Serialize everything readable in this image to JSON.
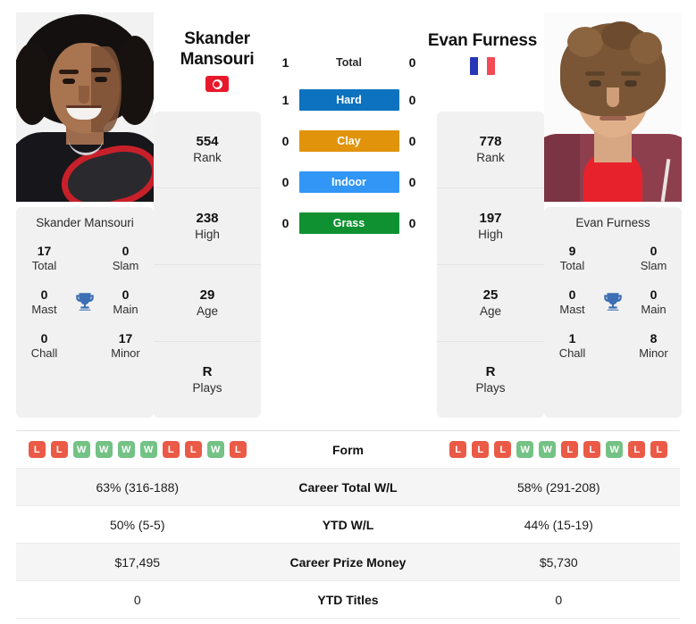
{
  "players": {
    "left": {
      "name_line1": "Skander",
      "name_line2": "Mansouri",
      "full_name": "Skander Mansouri",
      "country_flag": "tunisia-flag",
      "rank": "554",
      "rank_label": "Rank",
      "high": "238",
      "high_label": "High",
      "age": "29",
      "age_label": "Age",
      "plays": "R",
      "plays_label": "Plays",
      "titles": {
        "total": "17",
        "total_label": "Total",
        "slam": "0",
        "slam_label": "Slam",
        "mast": "0",
        "mast_label": "Mast",
        "main": "0",
        "main_label": "Main",
        "chall": "0",
        "chall_label": "Chall",
        "minor": "17",
        "minor_label": "Minor"
      },
      "form": [
        "L",
        "L",
        "W",
        "W",
        "W",
        "W",
        "L",
        "L",
        "W",
        "L"
      ],
      "career_total_wl": "63% (316-188)",
      "ytd_wl": "50% (5-5)",
      "career_prize_money": "$17,495",
      "ytd_titles": "0"
    },
    "right": {
      "name_line1": "Evan Furness",
      "name_line2": "",
      "full_name": "Evan Furness",
      "country_flag": "france-flag",
      "rank": "778",
      "rank_label": "Rank",
      "high": "197",
      "high_label": "High",
      "age": "25",
      "age_label": "Age",
      "plays": "R",
      "plays_label": "Plays",
      "titles": {
        "total": "9",
        "total_label": "Total",
        "slam": "0",
        "slam_label": "Slam",
        "mast": "0",
        "mast_label": "Mast",
        "main": "0",
        "main_label": "Main",
        "chall": "1",
        "chall_label": "Chall",
        "minor": "8",
        "minor_label": "Minor"
      },
      "form": [
        "L",
        "L",
        "L",
        "W",
        "W",
        "L",
        "L",
        "W",
        "L",
        "L"
      ],
      "career_total_wl": "58% (291-208)",
      "ytd_wl": "44% (15-19)",
      "career_prize_money": "$5,730",
      "ytd_titles": "0"
    }
  },
  "h2h": [
    {
      "label": "Total",
      "left": "1",
      "right": "0",
      "badge": false,
      "color": ""
    },
    {
      "label": "Hard",
      "left": "1",
      "right": "0",
      "badge": true,
      "color": "#0d72bf"
    },
    {
      "label": "Clay",
      "left": "0",
      "right": "0",
      "badge": true,
      "color": "#e0930b"
    },
    {
      "label": "Indoor",
      "left": "0",
      "right": "0",
      "badge": true,
      "color": "#3196f5"
    },
    {
      "label": "Grass",
      "left": "0",
      "right": "0",
      "badge": true,
      "color": "#0f9132"
    }
  ],
  "comparison_rows": [
    {
      "label": "Form",
      "type": "form",
      "left": "",
      "right": ""
    },
    {
      "label": "Career Total W/L",
      "type": "text",
      "left": "63% (316-188)",
      "right": "58% (291-208)"
    },
    {
      "label": "YTD W/L",
      "type": "text",
      "left": "50% (5-5)",
      "right": "44% (15-19)"
    },
    {
      "label": "Career Prize Money",
      "type": "text",
      "left": "$17,495",
      "right": "$5,730"
    },
    {
      "label": "YTD Titles",
      "type": "text",
      "left": "0",
      "right": "0"
    }
  ],
  "colors": {
    "hard": "#0d72bf",
    "clay": "#e0930b",
    "indoor": "#3196f5",
    "grass": "#0f9132",
    "win": "#74c285",
    "loss": "#ea5a47",
    "trophy": "#3d6fb4",
    "card_bg": "#f1f1f1"
  }
}
